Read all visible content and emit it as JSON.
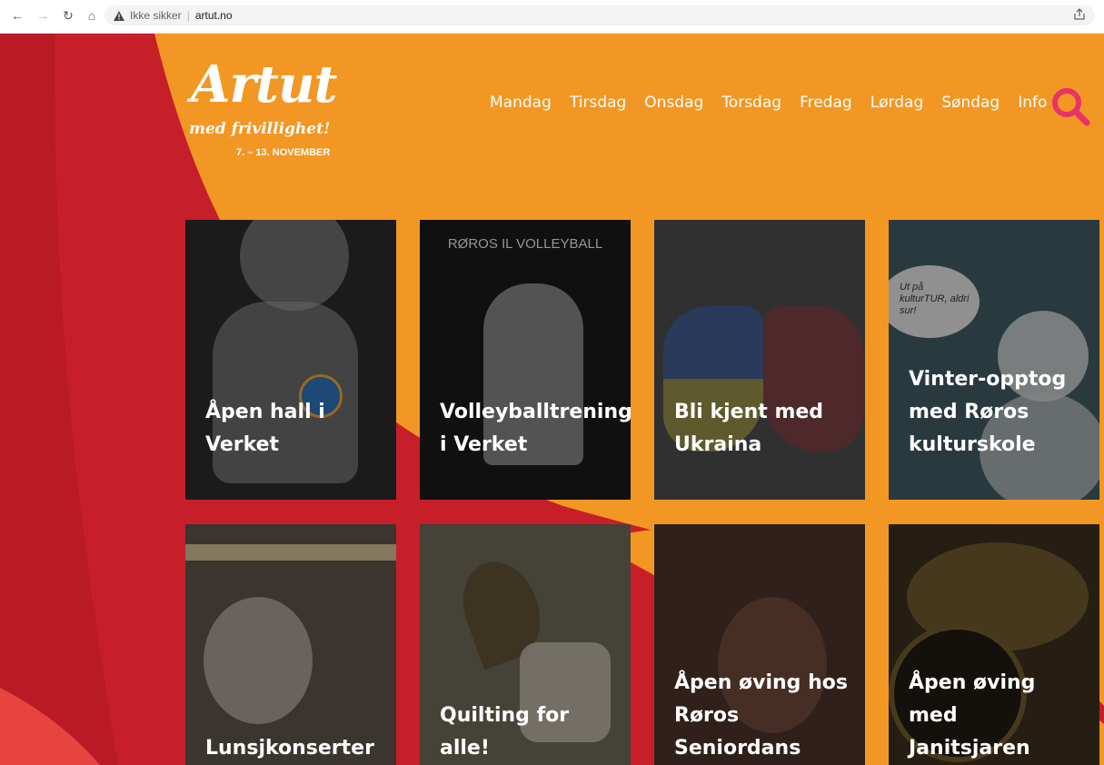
{
  "browser": {
    "security_label": "Ikke sikker",
    "separator": "|",
    "url": "artut.no"
  },
  "logo": {
    "title": "Artut",
    "subtitle": "med frivillighet!",
    "dates": "7. – 13. NOVEMBER"
  },
  "menu": [
    "Mandag",
    "Tirsdag",
    "Onsdag",
    "Torsdag",
    "Fredag",
    "Lørdag",
    "Søndag",
    "Info"
  ],
  "cards": [
    {
      "title_lines": [
        "Åpen hall i Verket"
      ]
    },
    {
      "title_lines": [
        "Volleyballtrening",
        "i Verket"
      ],
      "poster_text": "RØROS IL VOLLEYBALL"
    },
    {
      "title_lines": [
        "Bli kjent med",
        "Ukraina"
      ]
    },
    {
      "title_lines": [
        "Vinter-opptog",
        "med Røros",
        "kulturskole"
      ],
      "bubble_text": "Ut på kulturTUR, aldri sur!"
    },
    {
      "title_lines": [
        "Lunsjkonserter"
      ]
    },
    {
      "title_lines": [
        "Quilting for alle!"
      ]
    },
    {
      "title_lines": [
        "Åpen øving hos",
        "Røros",
        "Seniordans"
      ]
    },
    {
      "title_lines": [
        "Åpen øving med",
        "Janitsjaren"
      ]
    }
  ],
  "colors": {
    "orange": "#f29724",
    "red": "#c71f2a",
    "search_pink": "#e8336a"
  }
}
